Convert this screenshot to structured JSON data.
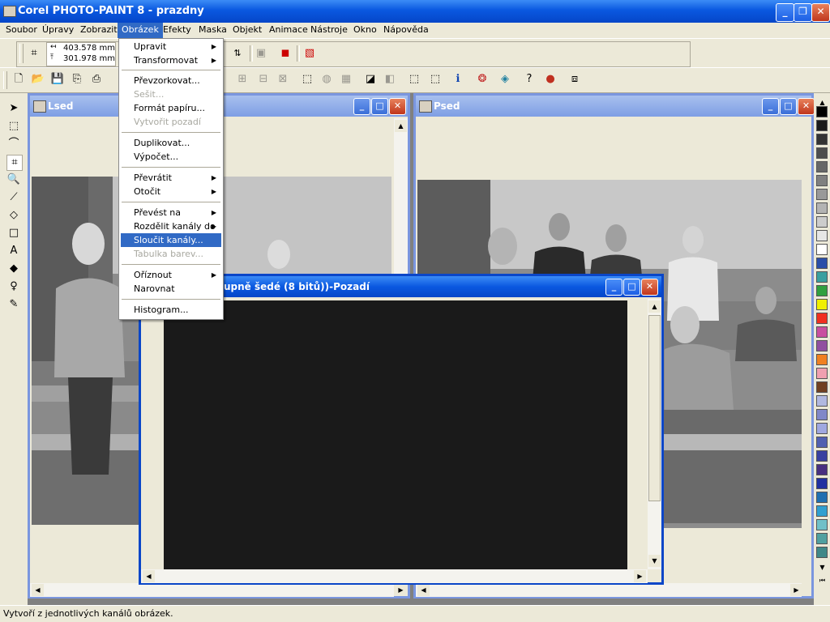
{
  "app": {
    "title": "Corel PHOTO-PAINT 8 - prazdny"
  },
  "menubar": {
    "items": [
      "Soubor",
      "Úpravy",
      "Zobrazit",
      "Obrázek",
      "Efekty",
      "Maska",
      "Objekt",
      "Animace",
      "Nástroje",
      "Okno",
      "Nápověda"
    ],
    "active": "Obrázek"
  },
  "toolbar_top": {
    "width_value": "403.578 mm",
    "height_value": "301.978 mm"
  },
  "dropdown": {
    "items": [
      {
        "label": "Upravit",
        "submenu": true,
        "disabled": false
      },
      {
        "label": "Transformovat",
        "submenu": true,
        "disabled": false
      },
      {
        "label": "Převzorkovat...",
        "submenu": false,
        "disabled": false
      },
      {
        "label": "Sešit...",
        "submenu": false,
        "disabled": true
      },
      {
        "label": "Formát papíru...",
        "submenu": false,
        "disabled": false
      },
      {
        "label": "Vytvořit pozadí",
        "submenu": false,
        "disabled": true
      },
      {
        "label": "Duplikovat...",
        "submenu": false,
        "disabled": false
      },
      {
        "label": "Výpočet...",
        "submenu": false,
        "disabled": false
      },
      {
        "label": "Převrátit",
        "submenu": true,
        "disabled": false
      },
      {
        "label": "Otočit",
        "submenu": true,
        "disabled": false
      },
      {
        "label": "Převést na",
        "submenu": true,
        "disabled": false
      },
      {
        "label": "Rozdělit kanály do",
        "submenu": true,
        "disabled": false
      },
      {
        "label": "Sloučit kanály...",
        "submenu": false,
        "disabled": false,
        "highlighted": true
      },
      {
        "label": "Tabulka barev...",
        "submenu": false,
        "disabled": true
      },
      {
        "label": "Oříznout",
        "submenu": true,
        "disabled": false
      },
      {
        "label": "Narovnat",
        "submenu": false,
        "disabled": false
      },
      {
        "label": "Histogram...",
        "submenu": false,
        "disabled": false
      }
    ]
  },
  "windows": {
    "lsed": {
      "title": "Lsed"
    },
    "psed": {
      "title": "Psed"
    },
    "active": {
      "title": "upně šedé (8 bitů))-Pozadí"
    }
  },
  "status": {
    "text": "Vytvoří z jednotlivých kanálů obrázek."
  },
  "icons": [
    "app-icon",
    "crop-icon",
    "new-icon",
    "open-icon",
    "save-icon",
    "print-icon",
    "info-icon",
    "help-icon",
    "pick-icon",
    "rect-mask-icon",
    "lasso-icon",
    "zoom-icon",
    "eyedropper-icon",
    "eraser-icon",
    "rectangle-icon",
    "text-icon",
    "fill-icon",
    "brush-icon"
  ],
  "colors": {
    "accent": "#316ac5",
    "titlebar": "#0a58e0",
    "canvas_dark": "#1a1a1a",
    "workspace": "#808080"
  }
}
